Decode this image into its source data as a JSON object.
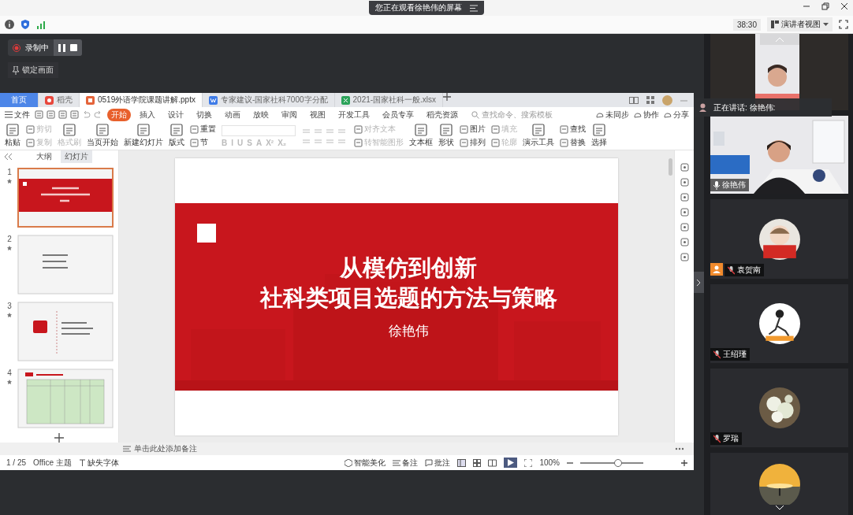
{
  "banner": {
    "text": "您正在观看徐艳伟的屏幕"
  },
  "toolbar": {
    "timer": "38:30",
    "view_button": "演讲者视图"
  },
  "recording": {
    "label": "录制中",
    "lock_label": "锁定画面"
  },
  "wps": {
    "tabs": [
      {
        "label": "首页",
        "kind": "home",
        "selected": false
      },
      {
        "label": "稻壳",
        "kind": "daoke",
        "selected": false
      },
      {
        "label": "0519外语学院课题讲解.pptx",
        "kind": "ppt",
        "selected": true
      },
      {
        "label": "专家建议-国家社科7000字分配",
        "kind": "doc",
        "selected": false
      },
      {
        "label": "2021-国家社科一般.xlsx",
        "kind": "xls",
        "selected": false
      }
    ],
    "file_menu": "文件",
    "menu": [
      {
        "label": "开始",
        "selected": true
      },
      {
        "label": "插入",
        "selected": false
      },
      {
        "label": "设计",
        "selected": false
      },
      {
        "label": "切换",
        "selected": false
      },
      {
        "label": "动画",
        "selected": false
      },
      {
        "label": "放映",
        "selected": false
      },
      {
        "label": "审阅",
        "selected": false
      },
      {
        "label": "视图",
        "selected": false
      },
      {
        "label": "开发工具",
        "selected": false
      },
      {
        "label": "会员专享",
        "selected": false
      },
      {
        "label": "稻壳资源",
        "selected": false
      }
    ],
    "search": {
      "placeholder": "查找命令、搜索模板"
    },
    "actions": [
      "未同步",
      "协作",
      "分享"
    ],
    "ribbon": [
      {
        "kind": "large",
        "label": "粘贴",
        "disabled": false
      },
      {
        "kind": "pair",
        "items": [
          {
            "label": "剪切",
            "disabled": true
          },
          {
            "label": "复制",
            "disabled": true
          }
        ]
      },
      {
        "kind": "large",
        "label": "格式刷",
        "disabled": true
      },
      {
        "kind": "large",
        "label": "当页开始",
        "disabled": false
      },
      {
        "kind": "large",
        "label": "新建幻灯片",
        "disabled": false
      },
      {
        "kind": "large",
        "label": "版式",
        "disabled": false
      },
      {
        "kind": "pair",
        "items": [
          {
            "label": "重置",
            "disabled": false
          },
          {
            "label": "节",
            "disabled": false
          }
        ]
      },
      {
        "kind": "font",
        "buttons": [
          {
            "label": "B",
            "disabled": true
          },
          {
            "label": "I",
            "disabled": true
          },
          {
            "label": "U",
            "disabled": true
          },
          {
            "label": "S",
            "disabled": true
          },
          {
            "label": "A",
            "disabled": true
          },
          {
            "label": "X²",
            "disabled": true
          },
          {
            "label": "X₂",
            "disabled": true
          }
        ]
      },
      {
        "kind": "paragraph"
      },
      {
        "kind": "pair",
        "items": [
          {
            "label": "对齐文本",
            "disabled": true
          },
          {
            "label": "转智能图形",
            "disabled": true
          }
        ]
      },
      {
        "kind": "large",
        "label": "文本框",
        "disabled": false
      },
      {
        "kind": "large",
        "label": "形状",
        "disabled": false
      },
      {
        "kind": "pair",
        "items": [
          {
            "label": "图片",
            "disabled": false
          },
          {
            "label": "排列",
            "disabled": false
          }
        ]
      },
      {
        "kind": "pair",
        "items": [
          {
            "label": "填充",
            "disabled": true
          },
          {
            "label": "轮廓",
            "disabled": true
          }
        ]
      },
      {
        "kind": "large",
        "label": "演示工具",
        "disabled": false
      },
      {
        "kind": "pair",
        "items": [
          {
            "label": "查找",
            "disabled": false
          },
          {
            "label": "替换",
            "disabled": false
          }
        ]
      },
      {
        "kind": "large",
        "label": "选择",
        "disabled": false
      }
    ],
    "panel_tabs": [
      {
        "label": "大纲",
        "selected": false
      },
      {
        "label": "幻灯片",
        "selected": true
      }
    ],
    "slides": [
      {
        "number": "1",
        "kind": "title",
        "selected": true
      },
      {
        "number": "2",
        "kind": "list",
        "selected": false
      },
      {
        "number": "3",
        "kind": "contents",
        "selected": false
      },
      {
        "number": "4",
        "kind": "table",
        "selected": false
      }
    ],
    "slide": {
      "title_lines": [
        "从模仿到创新",
        "社科类项目选题的方法与策略"
      ],
      "author": "徐艳伟"
    },
    "notes_placeholder": "单击此处添加备注",
    "status": {
      "page": "1 / 25",
      "theme": "Office 主题",
      "missing_font": "缺失字体",
      "beautify": "智能美化",
      "notes": "备注",
      "comments": "批注",
      "zoom": "100%",
      "level": 0.6
    }
  },
  "speaking": "正在讲话: 徐艳伟:",
  "participants": [
    {
      "kind": "video"
    },
    {
      "kind": "video",
      "name": "徐艳伟",
      "mic_on": true,
      "badge": false
    },
    {
      "kind": "avatar",
      "name": "袁贺南",
      "mic_on": false,
      "badge": true
    },
    {
      "kind": "avatar",
      "name": "王绍瑾",
      "mic_on": false,
      "badge": false
    },
    {
      "kind": "avatar",
      "name": "罗瑞",
      "mic_on": false,
      "badge": false
    },
    {
      "kind": "avatar"
    }
  ]
}
